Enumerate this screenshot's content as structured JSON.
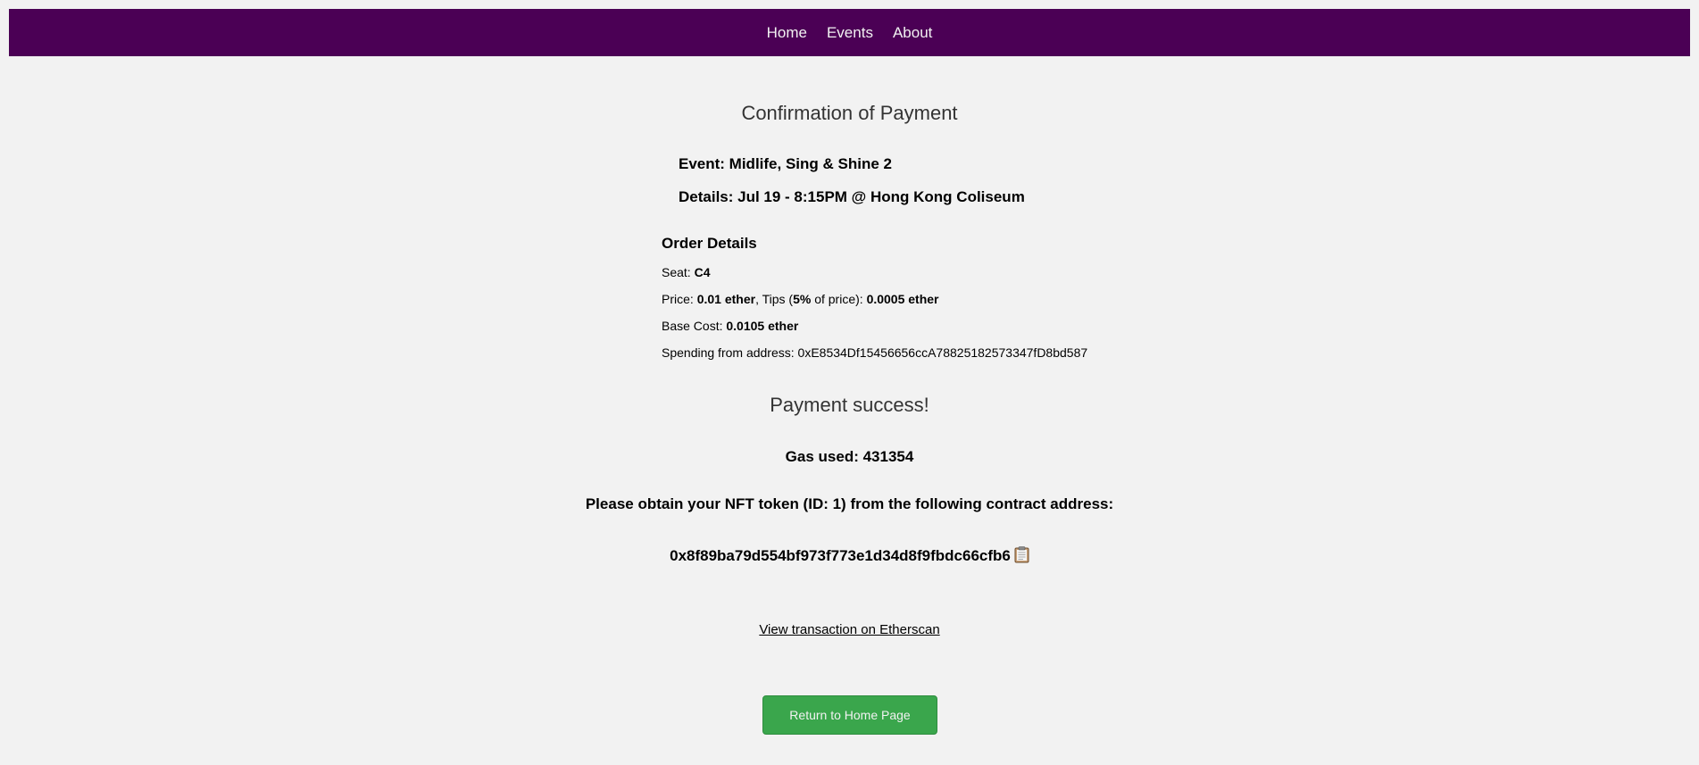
{
  "nav": {
    "items": [
      {
        "label": "Home"
      },
      {
        "label": "Events"
      },
      {
        "label": "About"
      }
    ]
  },
  "confirmation": {
    "title": "Confirmation of Payment",
    "event_line": "Event: Midlife, Sing & Shine 2",
    "details_line": "Details: Jul 19 - 8:15PM @ Hong Kong Coliseum"
  },
  "order": {
    "heading": "Order Details",
    "seat_label": "Seat: ",
    "seat_value": "C4",
    "price_label": "Price: ",
    "price_value": "0.01 ether",
    "tips_label_a": ", Tips (",
    "tips_percent": "5%",
    "tips_label_b": " of price): ",
    "tips_value": "0.0005 ether",
    "base_label": "Base Cost: ",
    "base_value": "0.0105 ether",
    "spending_label": "Spending from address: ",
    "spending_address": "0xE8534Df15456656ccA78825182573347fD8bd587"
  },
  "result": {
    "status": "Payment success!",
    "gas_line": "Gas used: 431354",
    "nft_line": "Please obtain your NFT token (ID: 1) from the following contract address:",
    "contract_address": "0x8f89ba79d554bf973f773e1d34d8f9fbdc66cfb6",
    "etherscan_link": "View transaction on Etherscan",
    "return_button": "Return to Home Page"
  },
  "icons": {
    "copy": "clipboard-icon"
  },
  "colors": {
    "navbar": "#4b0055",
    "button": "#3aa64c",
    "background": "#f2f2f2"
  }
}
